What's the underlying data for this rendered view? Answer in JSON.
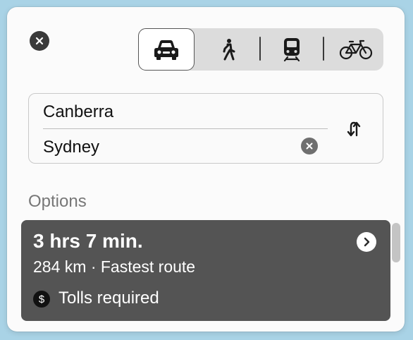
{
  "header": {
    "close_icon": "close-icon",
    "transport_modes": [
      {
        "name": "car",
        "icon": "car-icon",
        "selected": true
      },
      {
        "name": "walk",
        "icon": "walk-icon",
        "selected": false
      },
      {
        "name": "transit",
        "icon": "train-icon",
        "selected": false
      },
      {
        "name": "cycle",
        "icon": "bicycle-icon",
        "selected": false
      }
    ]
  },
  "route": {
    "from": "Canberra",
    "to": "Sydney"
  },
  "options": {
    "label": "Options",
    "routes": [
      {
        "time": "3 hrs 7 min.",
        "detail": "284 km · Fastest route",
        "note": "Tolls required",
        "note_icon": "dollar-icon"
      }
    ]
  },
  "colors": {
    "card_bg": "#545454",
    "panel_bg": "#fbfbfb",
    "window_bg": "#a9d3e6"
  }
}
